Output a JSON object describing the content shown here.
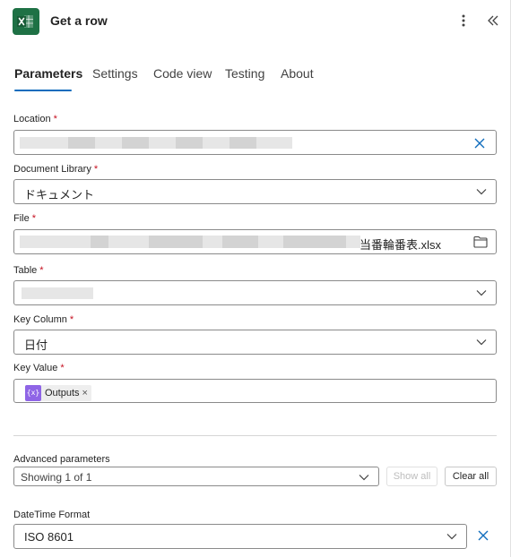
{
  "header": {
    "title": "Get a row",
    "app_icon": "excel-icon",
    "more_icon": "more-vertical-icon",
    "collapse_icon": "double-chevron-left-icon"
  },
  "tabs": [
    {
      "label": "Parameters",
      "active": true
    },
    {
      "label": "Settings"
    },
    {
      "label": "Code view"
    },
    {
      "label": "Testing"
    },
    {
      "label": "About"
    }
  ],
  "fields": {
    "location": {
      "label": "Location",
      "required": "*",
      "value": ""
    },
    "document_library": {
      "label": "Document Library",
      "required": "*",
      "value": "ドキュメント"
    },
    "file": {
      "label": "File",
      "required": "*",
      "value_suffix": "当番輪番表.xlsx"
    },
    "table": {
      "label": "Table",
      "required": "*",
      "value": ""
    },
    "key_column": {
      "label": "Key Column",
      "required": "*",
      "value": "日付"
    },
    "key_value": {
      "label": "Key Value",
      "required": "*",
      "token": "Outputs",
      "token_remove": "×",
      "token_icon_text": "{x}"
    }
  },
  "advanced": {
    "label": "Advanced parameters",
    "selector_value": "Showing 1 of 1",
    "show_all": "Show all",
    "clear_all": "Clear all"
  },
  "datetime": {
    "label": "DateTime Format",
    "value": "ISO 8601"
  },
  "colors": {
    "accent": "#0f6cbd",
    "excel_green": "#1e7145",
    "required": "#c50f1f",
    "token_purple": "#8f65e6"
  }
}
